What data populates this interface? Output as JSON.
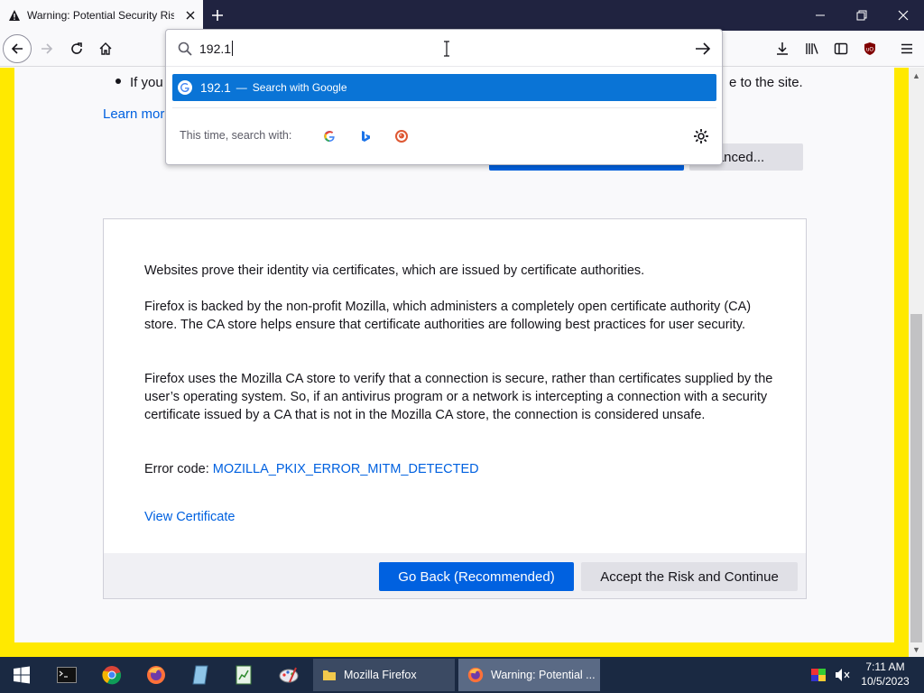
{
  "browser": {
    "tab_title": "Warning: Potential Security Risk Ahead",
    "url_input_value": "192.1"
  },
  "page": {
    "bullet_start": "If you",
    "bullet_end": "e to the site.",
    "learn_more": "Learn more",
    "advanced_label": "dvanced...",
    "paragraph1": "Websites prove their identity via certificates, which are issued by certificate authorities.",
    "paragraph2": "Firefox is backed by the non-profit Mozilla, which administers a completely open certificate authority (CA) store. The CA store helps ensure that certificate authorities are following best practices for user security.",
    "paragraph3": "Firefox uses the Mozilla CA store to verify that a connection is secure, rather than certificates supplied by the user’s operating system. So, if an antivirus program or a network is intercepting a connection with a security certificate issued by a CA that is not in the Mozilla CA store, the connection is considered unsafe.",
    "error_code_label": "Error code: ",
    "error_code": "MOZILLA_PKIX_ERROR_MITM_DETECTED",
    "view_certificate": "View Certificate",
    "go_back_button": "Go Back (Recommended)",
    "accept_button": "Accept the Risk and Continue"
  },
  "urlbar_popup": {
    "suggestion_query": "192.1",
    "suggestion_separator": "—",
    "suggestion_action": "Search with Google",
    "oneoff_label": "This time, search with:",
    "oneoff_engines": [
      "google-icon",
      "bing-icon",
      "duckduckgo-icon"
    ]
  },
  "taskbar": {
    "windows": [
      {
        "label": "Mozilla Firefox"
      },
      {
        "label": "Warning: Potential ..."
      }
    ],
    "time": "7:11 AM",
    "date": "10/5/2023"
  },
  "colors": {
    "accent_blue": "#0061e0",
    "suggestion_highlight": "#0a74d6",
    "warning_border": "#ffe900",
    "titlebar": "#202340",
    "taskbar": "#1a2942"
  }
}
